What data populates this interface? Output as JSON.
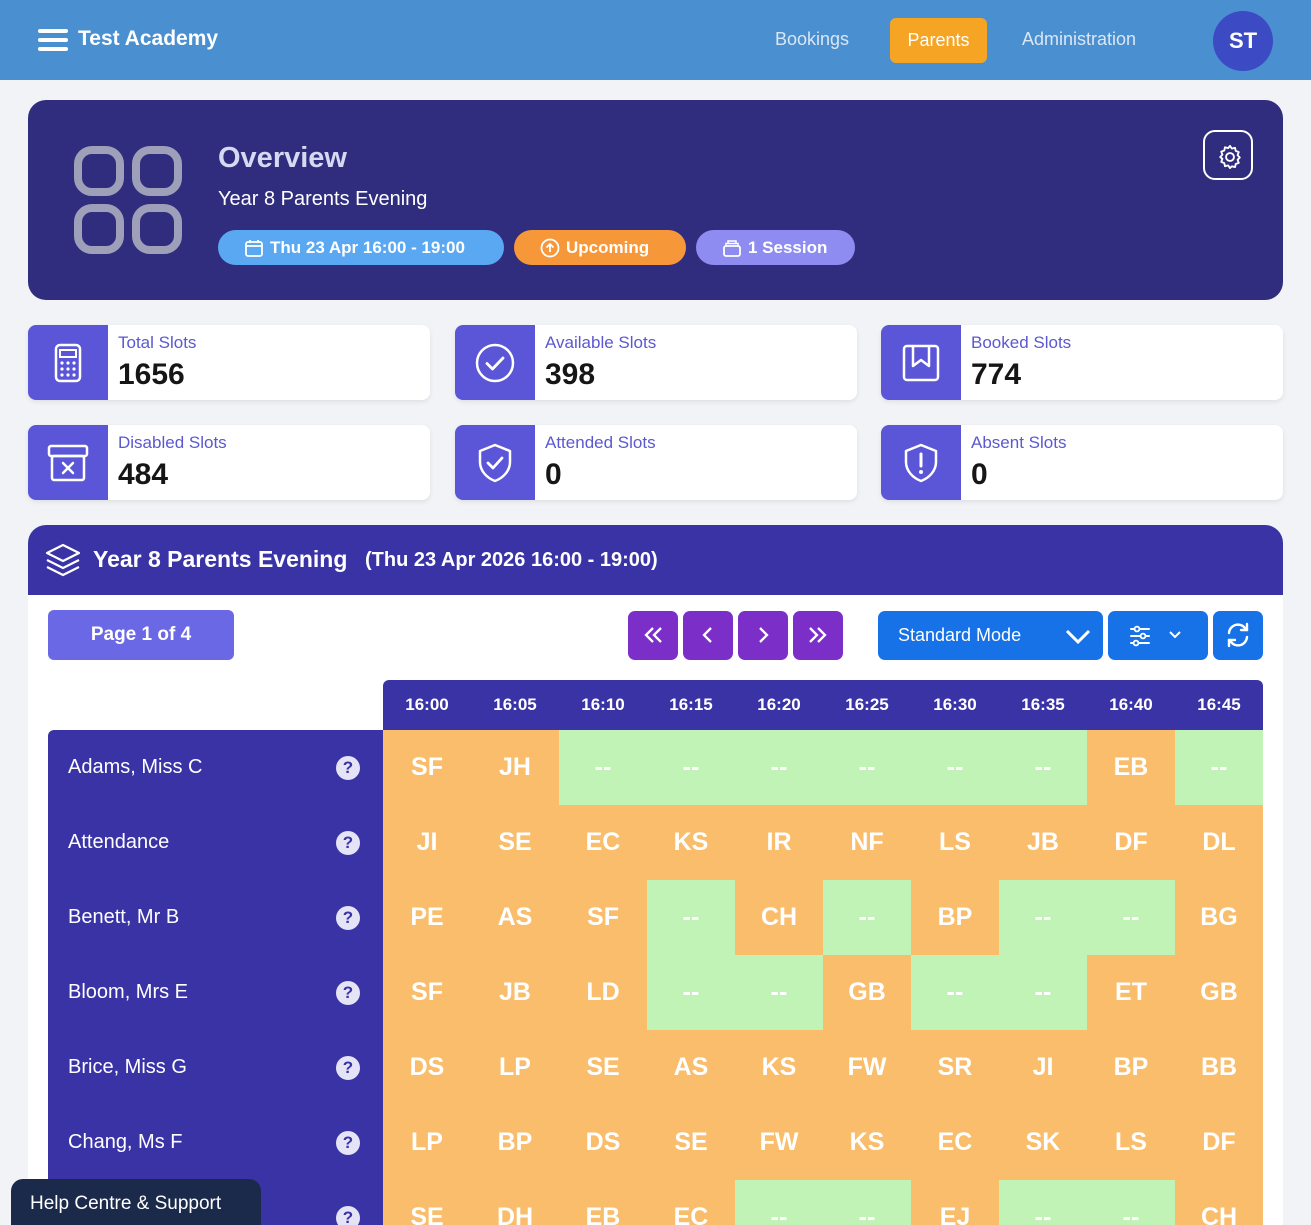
{
  "header": {
    "brand": "Test Academy",
    "nav": [
      {
        "label": "Bookings"
      },
      {
        "label": "Parents"
      },
      {
        "label": "Administration"
      }
    ],
    "avatar_initials": "ST"
  },
  "overview": {
    "title": "Overview",
    "subtitle": "Year 8 Parents Evening",
    "date_pill": "Thu 23 Apr 16:00 - 19:00",
    "status_pill": "Upcoming",
    "session_pill": "1 Session"
  },
  "stats": [
    {
      "label": "Total Slots",
      "value": "1656",
      "icon": "calculator-icon"
    },
    {
      "label": "Available Slots",
      "value": "398",
      "icon": "check-circle-icon"
    },
    {
      "label": "Booked Slots",
      "value": "774",
      "icon": "bookmark-icon"
    },
    {
      "label": "Disabled Slots",
      "value": "484",
      "icon": "archive-x-icon"
    },
    {
      "label": "Attended Slots",
      "value": "0",
      "icon": "shield-check-icon"
    },
    {
      "label": "Absent Slots",
      "value": "0",
      "icon": "shield-alert-icon"
    }
  ],
  "schedule": {
    "title": "Year 8 Parents Evening",
    "subtitle": "(Thu 23 Apr 2026 16:00 - 19:00)",
    "page_label": "Page 1 of 4",
    "mode_label": "Standard Mode",
    "times": [
      "16:00",
      "16:05",
      "16:10",
      "16:15",
      "16:20",
      "16:25",
      "16:30",
      "16:35",
      "16:40",
      "16:45"
    ],
    "rows": [
      {
        "name": "Adams, Miss C",
        "cells": [
          "SF",
          "JH",
          "--",
          "--",
          "--",
          "--",
          "--",
          "--",
          "EB",
          "--"
        ]
      },
      {
        "name": "Attendance",
        "cells": [
          "JI",
          "SE",
          "EC",
          "KS",
          "IR",
          "NF",
          "LS",
          "JB",
          "DF",
          "DL"
        ]
      },
      {
        "name": "Benett, Mr B",
        "cells": [
          "PE",
          "AS",
          "SF",
          "--",
          "CH",
          "--",
          "BP",
          "--",
          "--",
          "BG"
        ]
      },
      {
        "name": "Bloom, Mrs E",
        "cells": [
          "SF",
          "JB",
          "LD",
          "--",
          "--",
          "GB",
          "--",
          "--",
          "ET",
          "GB"
        ]
      },
      {
        "name": "Brice, Miss G",
        "cells": [
          "DS",
          "LP",
          "SE",
          "AS",
          "KS",
          "FW",
          "SR",
          "JI",
          "BP",
          "BB"
        ]
      },
      {
        "name": "Chang, Ms F",
        "cells": [
          "LP",
          "BP",
          "DS",
          "SE",
          "FW",
          "KS",
          "EC",
          "SK",
          "LS",
          "DF"
        ]
      },
      {
        "name": "",
        "cells": [
          "SE",
          "DH",
          "EB",
          "EC",
          "--",
          "--",
          "EJ",
          "--",
          "--",
          "CH"
        ]
      }
    ]
  },
  "help_centre": "Help Centre & Support",
  "colors": {
    "topbar": "#4a8fd0",
    "active_nav": "#f6a423",
    "overview_bg": "#312d7e",
    "panel_header": "#3a33a6",
    "booked_cell": "#f9bd6c",
    "free_cell": "#c1f3b6"
  }
}
